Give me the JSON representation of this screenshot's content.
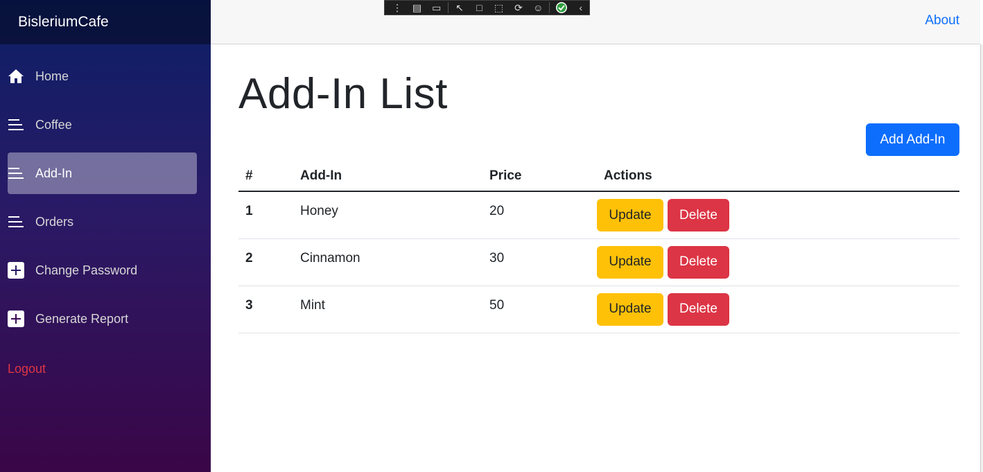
{
  "app": {
    "brand": "BisleriumCafe"
  },
  "sidebar": {
    "items": [
      {
        "label": "Home",
        "icon": "home-icon",
        "active": false
      },
      {
        "label": "Coffee",
        "icon": "list-icon",
        "active": false
      },
      {
        "label": "Add-In",
        "icon": "list-icon",
        "active": true
      },
      {
        "label": "Orders",
        "icon": "list-icon",
        "active": false
      },
      {
        "label": "Change Password",
        "icon": "plus-square-icon",
        "active": false
      },
      {
        "label": "Generate Report",
        "icon": "plus-square-icon",
        "active": false
      }
    ],
    "logout_label": "Logout"
  },
  "topbar": {
    "about_label": "About"
  },
  "page": {
    "title": "Add-In List",
    "add_button_label": "Add Add-In"
  },
  "table": {
    "headers": [
      "#",
      "Add-In",
      "Price",
      "Actions"
    ],
    "rows": [
      {
        "num": "1",
        "name": "Honey",
        "price": "20",
        "update_label": "Update",
        "delete_label": "Delete"
      },
      {
        "num": "2",
        "name": "Cinnamon",
        "price": "30",
        "update_label": "Update",
        "delete_label": "Delete"
      },
      {
        "num": "3",
        "name": "Mint",
        "price": "50",
        "update_label": "Update",
        "delete_label": "Delete"
      }
    ]
  },
  "colors": {
    "primary": "#0d6efd",
    "warning": "#ffc107",
    "danger": "#dc3545"
  }
}
